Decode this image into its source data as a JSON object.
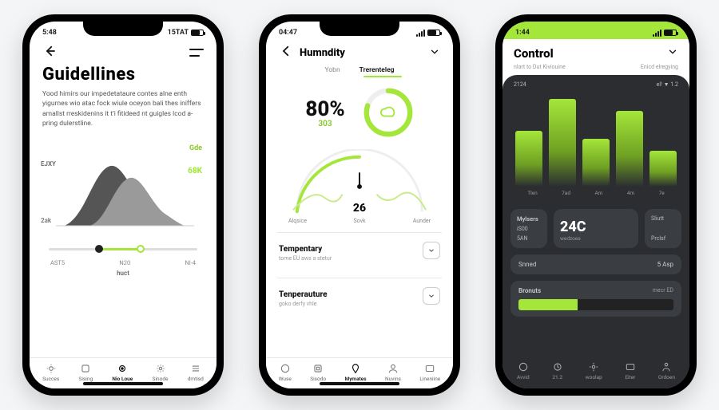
{
  "phone1": {
    "status": {
      "time": "5:48",
      "right": "15TAT"
    },
    "title": "Guidellines",
    "blurb": "Yood himirs our impedetataure contes alne enth yigurnes wio atac fock wiule oceyon bali thes iniffers amallst rreskidenins it t’i fitideed nt guigles lcod a-pring dulerstline.",
    "chart": {
      "g": "Gde",
      "k": "68K",
      "y1": "EJXY",
      "y2": "2ak"
    },
    "slider_ticks": [
      "AST5",
      "N20",
      "Nl-4"
    ],
    "huct": "huct",
    "tabs": [
      "Succes",
      "Sising",
      "Nio Loue",
      "Sinode",
      "dmtisd"
    ]
  },
  "phone2": {
    "status": {
      "time": "04:47"
    },
    "title": "Humndity",
    "tabs": [
      "Yobn",
      "Trerenteleg"
    ],
    "pct": {
      "big": "80%",
      "small": "303"
    },
    "gauge": {
      "value": "26",
      "sub": "Sovk",
      "left": "Alqsice",
      "right": "Aunder"
    },
    "sect1": {
      "title": "Tempentary",
      "sub": "tome EU aws a stetur"
    },
    "sect2": {
      "title": "Tenperauture",
      "sub": "goko derfy vhle"
    },
    "tabs_bottom": [
      "Wuse",
      "Sisodo",
      "Mymates",
      "Nuvins",
      "Lineniine"
    ]
  },
  "phone3": {
    "status": {
      "time": "1:44"
    },
    "title": "Control",
    "subrow": {
      "left": "nlart to Dut Kiviouine",
      "right": "Enicd elregying"
    },
    "dp_top": {
      "left": "2124",
      "right": "el! ▼ 1.2"
    },
    "chart_data": {
      "type": "bar",
      "categories": [
        "Tlen",
        "7ad",
        "Am",
        "4m",
        "7e"
      ],
      "values": [
        70,
        110,
        60,
        95,
        45
      ],
      "ylim": [
        0,
        120
      ],
      "title": "",
      "xlabel": "",
      "ylabel": ""
    },
    "card_left": {
      "lab": "Mylsers",
      "r1": "iS00",
      "r2": "5AN"
    },
    "card_mid": {
      "big": "24C",
      "sm": "wedzoes"
    },
    "card_right": {
      "r1": "Sliutt",
      "r2": "Prclsf"
    },
    "row": {
      "l": "Snned",
      "r": "5 Asp"
    },
    "bronuts": {
      "t": "Bronuts",
      "r": "mecr ED"
    },
    "tabs": [
      "Avvid",
      "21.2",
      "woolap",
      "Eiter",
      "Ordoen"
    ]
  }
}
